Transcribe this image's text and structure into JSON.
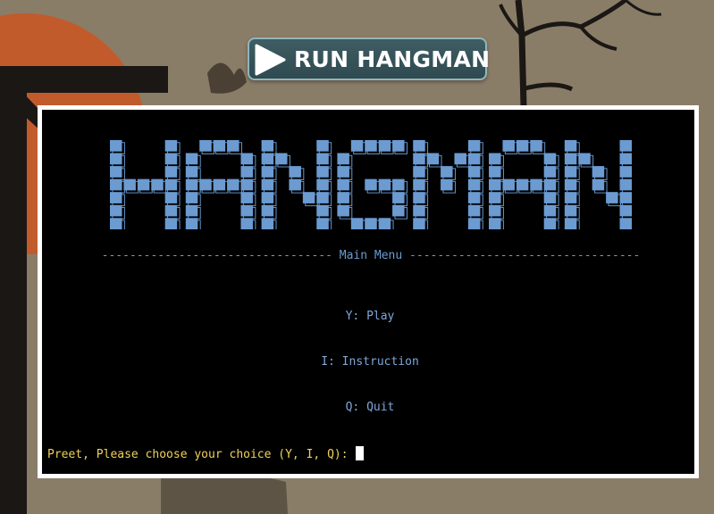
{
  "run_button": {
    "label": "RUN HANGMAN",
    "icon": "play-icon"
  },
  "terminal": {
    "logo_text": "HANGMAN",
    "menu_title": "Main Menu",
    "menu_items": [
      {
        "label": "Y: Play"
      },
      {
        "label": "I: Instruction"
      },
      {
        "label": "Q: Quit"
      }
    ],
    "prompt": "Preet, Please choose your choice (Y, I, Q):"
  },
  "colors": {
    "background": "#8a7d68",
    "moon": "#c15b2b",
    "button": "#3f5d64",
    "terminal_bg": "#000000",
    "logo_fill": "#6b9bd1",
    "menu_text": "#7ea7d8",
    "prompt_text": "#f0d25a"
  }
}
